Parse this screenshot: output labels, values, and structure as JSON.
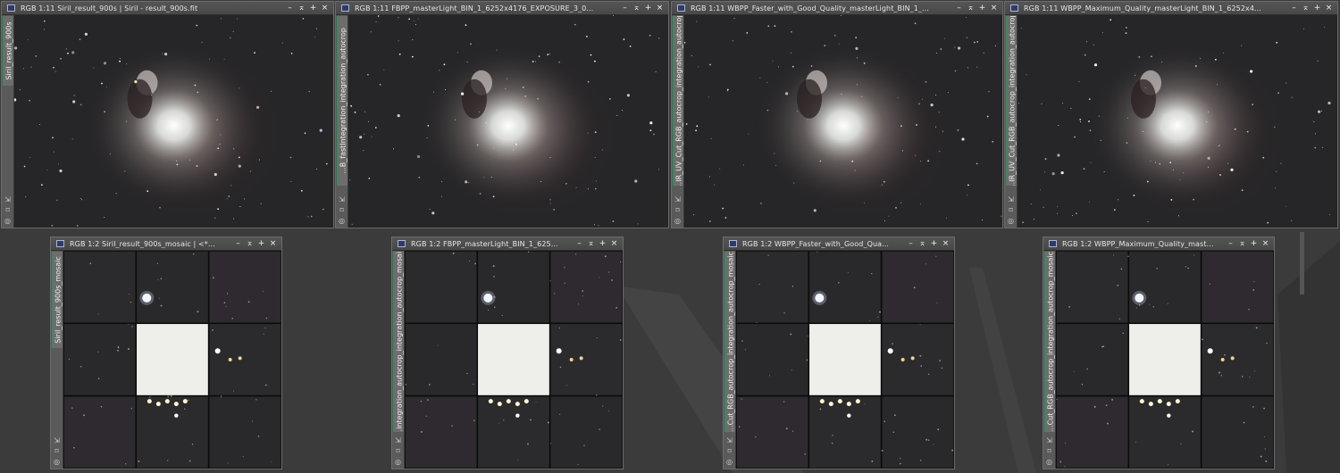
{
  "windows": [
    {
      "title": "RGB 1:11 Siril_result_900s | Siril - result_900s.fit",
      "tab": "Siril_result_900s",
      "view": "nebula"
    },
    {
      "title": "RGB 1:11 FBPP_masterLight_BIN_1_6252x4176_EXPOSURE_3_0...",
      "tab": "...B_fastIntegration_integration_autocrop",
      "view": "nebula"
    },
    {
      "title": "RGB 1:11 WBPP_Faster_with_Good_Quality_masterLight_BIN_1_...",
      "tab": "...IR_UV_Cut_RGB_autocrop_integration_autocrop",
      "view": "nebula"
    },
    {
      "title": "RGB 1:11 WBPP_Maximum_Quality_masterLight_BIN_1_6252x4...",
      "tab": "...IR_UV_Cut_RGB_autocrop_integration_autocrop",
      "view": "nebula"
    },
    {
      "title": "RGB 1:2 Siril_result_900s_mosaic | <*...",
      "tab": "Siril_result_900s_mosaic",
      "view": "mosaic"
    },
    {
      "title": "RGB 1:2 FBPP_masterLight_BIN_1_625...",
      "tab": "...integration_autocrop_integration_autocrop_mosaic",
      "view": "mosaic"
    },
    {
      "title": "RGB 1:2 WBPP_Faster_with_Good_Qua...",
      "tab": "...Cut_RGB_autocrop_integration_autocrop_mosaic",
      "view": "mosaic"
    },
    {
      "title": "RGB 1:2 WBPP_Maximum_Quality_mast...",
      "tab": "...Cut_RGB_autocrop_integration_autocrop_mosaic",
      "view": "mosaic"
    }
  ],
  "controls": {
    "minimize": "–",
    "shade": "⌅",
    "maximize": "+",
    "close": "×"
  },
  "side_icons": {
    "shrink": "⇲",
    "fit": "⌑",
    "zoom": "◎"
  },
  "colors": {
    "desktop": "#3b3b3b",
    "titlebar": "#4d4d4d",
    "sidebar": "#5a5a5a",
    "tab_accent": "#1f9b54",
    "window_border": "#6c6c6c"
  }
}
